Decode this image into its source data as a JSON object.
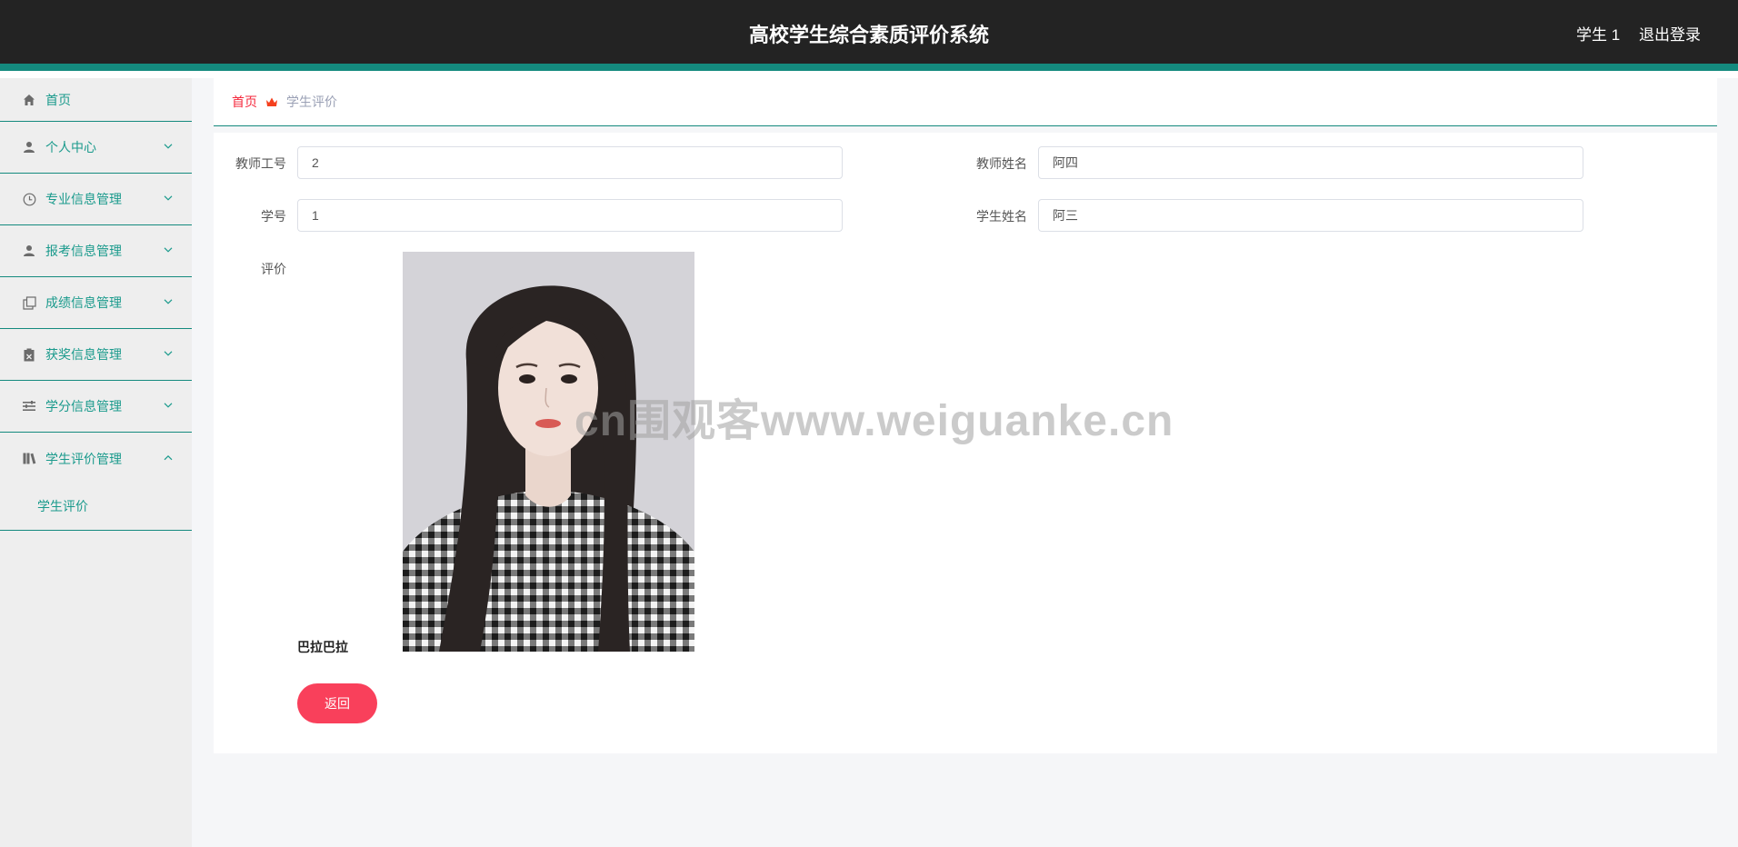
{
  "header": {
    "title": "高校学生综合素质评价系统",
    "user_name": "学生 1",
    "logout_label": "退出登录"
  },
  "sidebar": {
    "items": [
      {
        "label": "首页",
        "icon": "home-icon"
      },
      {
        "label": "个人中心",
        "icon": "person-icon"
      },
      {
        "label": "专业信息管理",
        "icon": "clock-icon"
      },
      {
        "label": "报考信息管理",
        "icon": "person-icon"
      },
      {
        "label": "成绩信息管理",
        "icon": "copy-icon"
      },
      {
        "label": "获奖信息管理",
        "icon": "clipboard-icon"
      },
      {
        "label": "学分信息管理",
        "icon": "list-icon"
      },
      {
        "label": "学生评价管理",
        "icon": "books-icon",
        "expanded": true,
        "children": [
          {
            "label": "学生评价"
          }
        ]
      }
    ]
  },
  "breadcrumb": {
    "home": "首页",
    "current": "学生评价"
  },
  "form": {
    "teacher_id_label": "教师工号",
    "teacher_id_value": "2",
    "teacher_name_label": "教师姓名",
    "teacher_name_value": "阿四",
    "student_id_label": "学号",
    "student_id_value": "1",
    "student_name_label": "学生姓名",
    "student_name_value": "阿三",
    "evaluation_label": "评价",
    "evaluation_text": "巴拉巴拉",
    "back_label": "返回"
  },
  "watermark": "cn围观客www.weiguanke.cn",
  "colors": {
    "header_bg": "#232323",
    "accent": "#148a7e",
    "menu_text": "#1a9a8c",
    "breadcrumb_home": "#f5283c",
    "back_button": "#f9405b"
  }
}
